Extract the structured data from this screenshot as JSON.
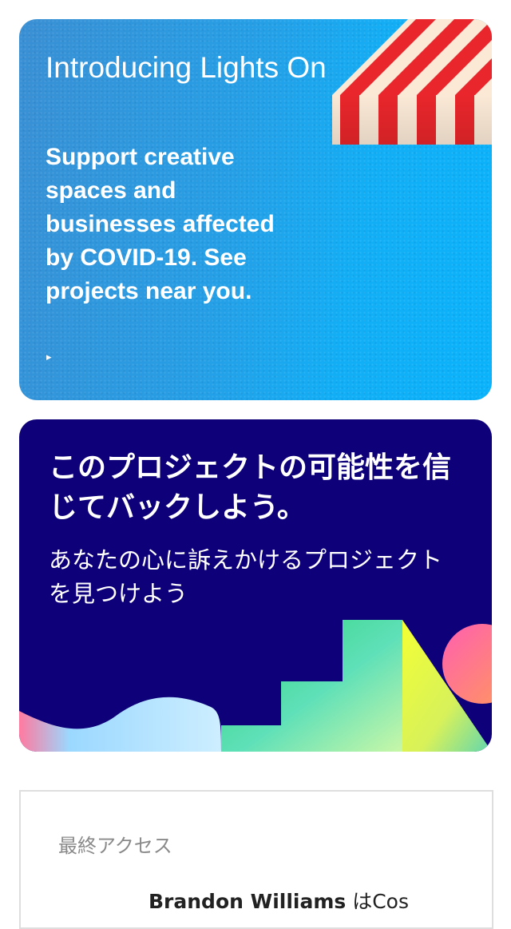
{
  "cards": {
    "lights_on": {
      "title": "Introducing Lights On",
      "body": "Support creative spaces and businesses affected by COVID-19. See projects near you.",
      "arrow": "▸"
    },
    "back_project": {
      "title": "このプロジェクトの可能性を信じてバックしよう。",
      "subtitle": "あなたの心に訴えかけるプロジェクトを見つけよう"
    },
    "recent": {
      "heading": "最終アクセス",
      "item_creator": "Brandon Williams",
      "item_text": " はCos"
    }
  },
  "colors": {
    "lights_bg": "#259fe6",
    "back_bg": "#0d0078",
    "awning_red": "#e8262b",
    "awning_cream": "#fbe9d6"
  }
}
